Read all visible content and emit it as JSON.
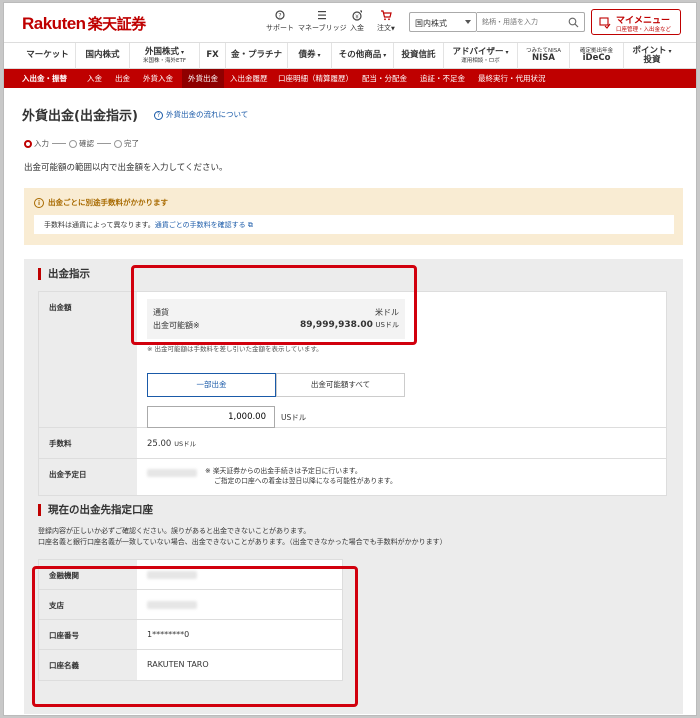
{
  "header": {
    "logo_en": "Rakuten",
    "logo_jp": "楽天証券",
    "icons": [
      {
        "name": "support",
        "label": "サポート"
      },
      {
        "name": "money-bridge",
        "label": "マネーブリッジ"
      },
      {
        "name": "deposit",
        "label": "入金"
      },
      {
        "name": "order",
        "label": "注文"
      }
    ],
    "segment_select": "国内株式",
    "search_placeholder": "銘柄・用語を入力",
    "mymenu_title": "マイメニュー",
    "mymenu_sub": "口座管理・入出金など"
  },
  "nav": [
    {
      "label": "マーケット",
      "sub": ""
    },
    {
      "label": "国内株式",
      "sub": ""
    },
    {
      "label": "外国株式",
      "sub": "米国株・海外ETF"
    },
    {
      "label": "FX",
      "sub": ""
    },
    {
      "label": "金・プラチナ",
      "sub": ""
    },
    {
      "label": "債券",
      "sub": ""
    },
    {
      "label": "その他商品",
      "sub": ""
    },
    {
      "label": "投資信託",
      "sub": ""
    },
    {
      "label": "アドバイザー",
      "sub": "運用相談・ロボ"
    },
    {
      "label": "つみたてNISA",
      "sub": "NISA"
    },
    {
      "label": "確定拠出年金",
      "sub": "iDeCo"
    },
    {
      "label": "ポイント",
      "sub": "投資"
    }
  ],
  "subnav": [
    "入出金・振替",
    "入金",
    "出金",
    "外貨入金",
    "外貨出金",
    "入出金履歴",
    "口座明細（精算履歴）",
    "配当・分配金",
    "追証・不足金",
    "最終実行・代用状況"
  ],
  "page": {
    "title": "外貨出金(出金指示)",
    "help_link": "外貨出金の流れについて",
    "steps": [
      "入力",
      "確認",
      "完了"
    ],
    "lead": "出金可能額の範囲以内で出金額を入力してください。"
  },
  "notice": {
    "title": "出金ごとに別途手数料がかかります",
    "body": "手数料は通貨によって異なります。",
    "link": "通貨ごとの手数料を確認する"
  },
  "instruction": {
    "section_title": "出金指示",
    "amount_label": "出金額",
    "currency_label": "通貨",
    "currency_value": "米ドル",
    "available_label": "出金可能額※",
    "available_value": "89,999,938.00",
    "available_unit": "USドル",
    "available_note": "※ 出金可能額は手数料を差し引いた金額を表示しています。",
    "btn_partial": "一部出金",
    "btn_all": "出金可能額すべて",
    "amount_value": "1,000.00",
    "amount_unit": "USドル",
    "fee_label": "手数料",
    "fee_value": "25.00",
    "fee_unit": "USドル",
    "date_label": "出金予定日",
    "date_note1": "※ 楽天証券からの出金手続きは予定日に行います。",
    "date_note2": "ご指定の口座への着金は翌日以降になる可能性があります。"
  },
  "account": {
    "section_title": "現在の出金先指定口座",
    "note1": "登録内容が正しいか必ずご確認ください。誤りがあると出金できないことがあります。",
    "note2": "口座名義と銀行口座名義が一致していない場合、出金できないことがあります。（出金できなかった場合でも手数料がかかります）",
    "rows": [
      {
        "label": "金融機関",
        "value": ""
      },
      {
        "label": "支店",
        "value": ""
      },
      {
        "label": "口座番号",
        "value": "1********0"
      },
      {
        "label": "口座名義",
        "value": "RAKUTEN TARO"
      }
    ]
  }
}
